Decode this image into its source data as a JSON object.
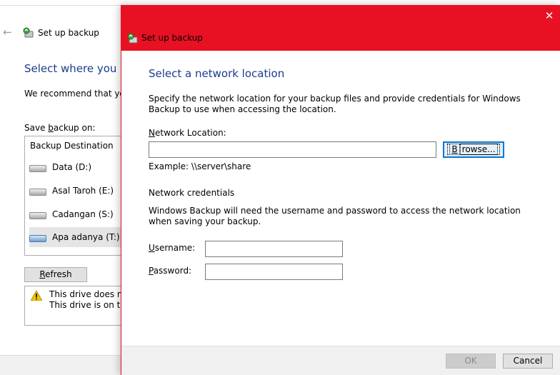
{
  "background_window": {
    "back_icon": "back-arrow-icon",
    "app_icon": "windows-backup-icon",
    "title": "Set up backup",
    "heading": "Select where you w",
    "recommend": "We recommend that you",
    "save_label_pre": "Save ",
    "save_label_key": "b",
    "save_label_post": "ackup on:",
    "list_header": "Backup Destination",
    "drives": [
      {
        "label": "Data (D:)",
        "icon": "hard-drive-icon",
        "selected": false
      },
      {
        "label": "Asal Taroh (E:)",
        "icon": "hard-drive-icon",
        "selected": false
      },
      {
        "label": "Cadangan (S:)",
        "icon": "hard-drive-icon",
        "selected": false
      },
      {
        "label": "Apa adanya (T:)",
        "icon": "network-drive-icon",
        "selected": true
      }
    ],
    "refresh_key": "R",
    "refresh_rest": "efresh",
    "warning_icon": "warning-icon",
    "warning_line1": "This drive does not",
    "warning_line2": "This drive is on the"
  },
  "dialog": {
    "title": "Set up backup",
    "app_icon": "windows-backup-icon",
    "close_icon": "close-icon",
    "close_glyph": "✕",
    "heading": "Select a network location",
    "description": "Specify the network location for your backup files and provide credentials for Windows Backup to use when accessing the location.",
    "network_location_key": "N",
    "network_location_rest": "etwork Location:",
    "network_location_value": "",
    "browse_key": "B",
    "browse_rest": "rowse...",
    "example": "Example: \\\\server\\share",
    "credentials_heading": "Network credentials",
    "credentials_description": "Windows Backup will need the username and password to access the network location when saving your backup.",
    "username_key": "U",
    "username_rest": "sername:",
    "username_value": "",
    "password_key": "P",
    "password_rest": "assword:",
    "password_value": "",
    "ok_label": "OK",
    "cancel_label": "Cancel"
  },
  "colors": {
    "titlebar": "#e81123",
    "heading": "#1a3c8c",
    "focus": "#0078d7"
  }
}
